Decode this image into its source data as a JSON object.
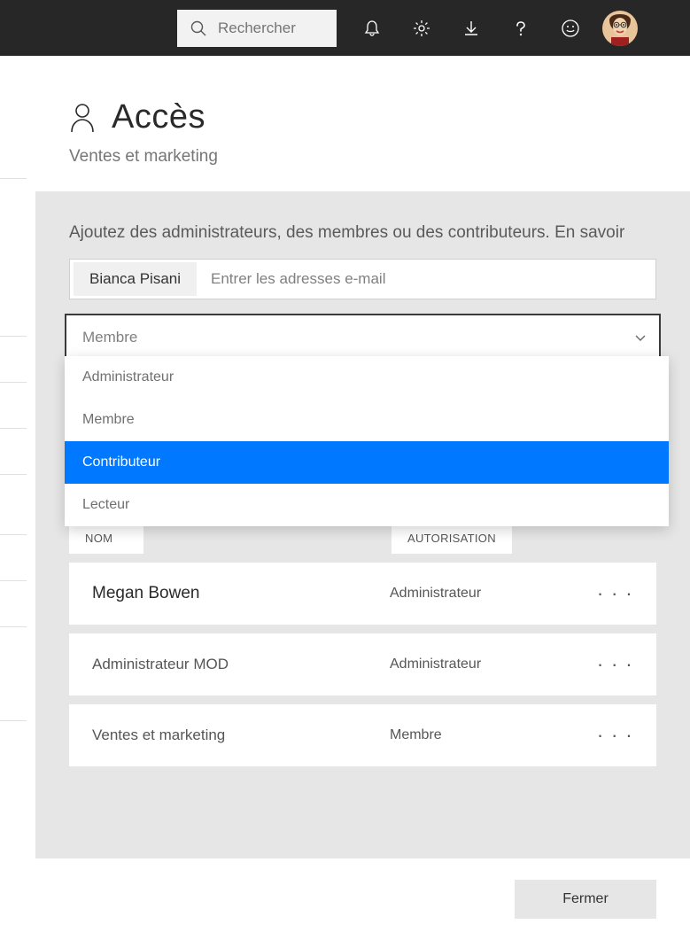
{
  "header": {
    "search_placeholder": "Rechercher"
  },
  "panel": {
    "title": "Accès",
    "subtitle": "Ventes et marketing",
    "instruction": "Ajoutez des administrateurs, des membres ou des contributeurs. En savoir",
    "chip_value": "Bianca Pisani",
    "email_placeholder": "Entrer les adresses e-mail",
    "select_value": "Membre",
    "dropdown": {
      "options": [
        {
          "label": "Administrateur",
          "selected": false
        },
        {
          "label": "Membre",
          "selected": false
        },
        {
          "label": "Contributeur",
          "selected": true
        },
        {
          "label": "Lecteur",
          "selected": false
        }
      ]
    },
    "table": {
      "col_name": "NOM",
      "col_auth": "AUTORISATION",
      "rows": [
        {
          "name": "Megan Bowen",
          "role": "Administrateur",
          "strong": true
        },
        {
          "name": "Administrateur MOD",
          "role": "Administrateur",
          "strong": false
        },
        {
          "name": "Ventes et marketing",
          "role": "Membre",
          "strong": false
        }
      ]
    },
    "close_label": "Fermer"
  }
}
